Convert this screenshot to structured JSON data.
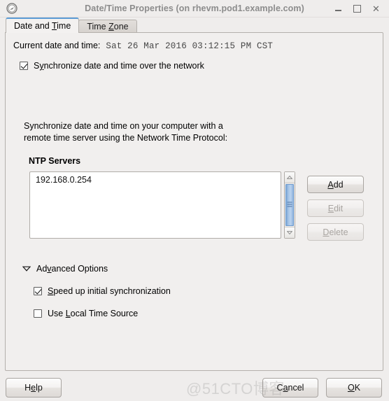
{
  "window": {
    "title": "Date/Time Properties (on rhevm.pod1.example.com)",
    "icon": "clock-icon",
    "controls": {
      "minimize": "minimize-icon",
      "maximize": "maximize-icon",
      "close": "✕"
    }
  },
  "tabs": [
    {
      "label": "Date and Time",
      "mnemonic": "T",
      "active": true
    },
    {
      "label": "Time Zone",
      "mnemonic": "Z",
      "active": false
    }
  ],
  "main": {
    "current_datetime_label": "Current date and time:",
    "current_datetime_value": "Sat 26 Mar 2016 03:12:15 PM CST",
    "sync_checkbox": {
      "label_before": "S",
      "label_mnemonic": "y",
      "label_after": "nchronize date and time over the network",
      "checked": true
    },
    "description_line1": "Synchronize date and time on your computer with a",
    "description_line2": "remote time server using the Network Time Protocol:",
    "ntp_group_title": "NTP Servers",
    "ntp_servers": [
      "192.168.0.254"
    ],
    "ntp_buttons": [
      {
        "id": "add",
        "label_before": "",
        "label_mnemonic": "A",
        "label_after": "dd",
        "enabled": true
      },
      {
        "id": "edit",
        "label_before": "",
        "label_mnemonic": "E",
        "label_after": "dit",
        "enabled": false
      },
      {
        "id": "delete",
        "label_before": "",
        "label_mnemonic": "D",
        "label_after": "elete",
        "enabled": false
      }
    ],
    "advanced": {
      "toggle_icon": "triangle-down-icon",
      "expanded": true,
      "label_before": "Ad",
      "label_mnemonic": "v",
      "label_after": "anced Options",
      "options": [
        {
          "label_before": "",
          "label_mnemonic": "S",
          "label_after": "peed up initial synchronization",
          "checked": true
        },
        {
          "label_before": "Use ",
          "label_mnemonic": "L",
          "label_after": "ocal Time Source",
          "checked": false
        }
      ]
    }
  },
  "footer": {
    "help": {
      "label_before": "H",
      "label_mnemonic": "e",
      "label_after": "lp"
    },
    "cancel": {
      "label_before": "C",
      "label_mnemonic": "a",
      "label_after": "ncel"
    },
    "ok": {
      "label_before": "",
      "label_mnemonic": "O",
      "label_after": "K"
    }
  },
  "watermark": "@51CTO博客",
  "colors": {
    "window_bg": "#efedec",
    "panel_bg": "#f1efee",
    "active_tab_accent": "#5b9bd5",
    "scroll_thumb": "#a8c6e8",
    "title_text": "#8c8c8c",
    "disabled_text": "#a9a5a1"
  }
}
